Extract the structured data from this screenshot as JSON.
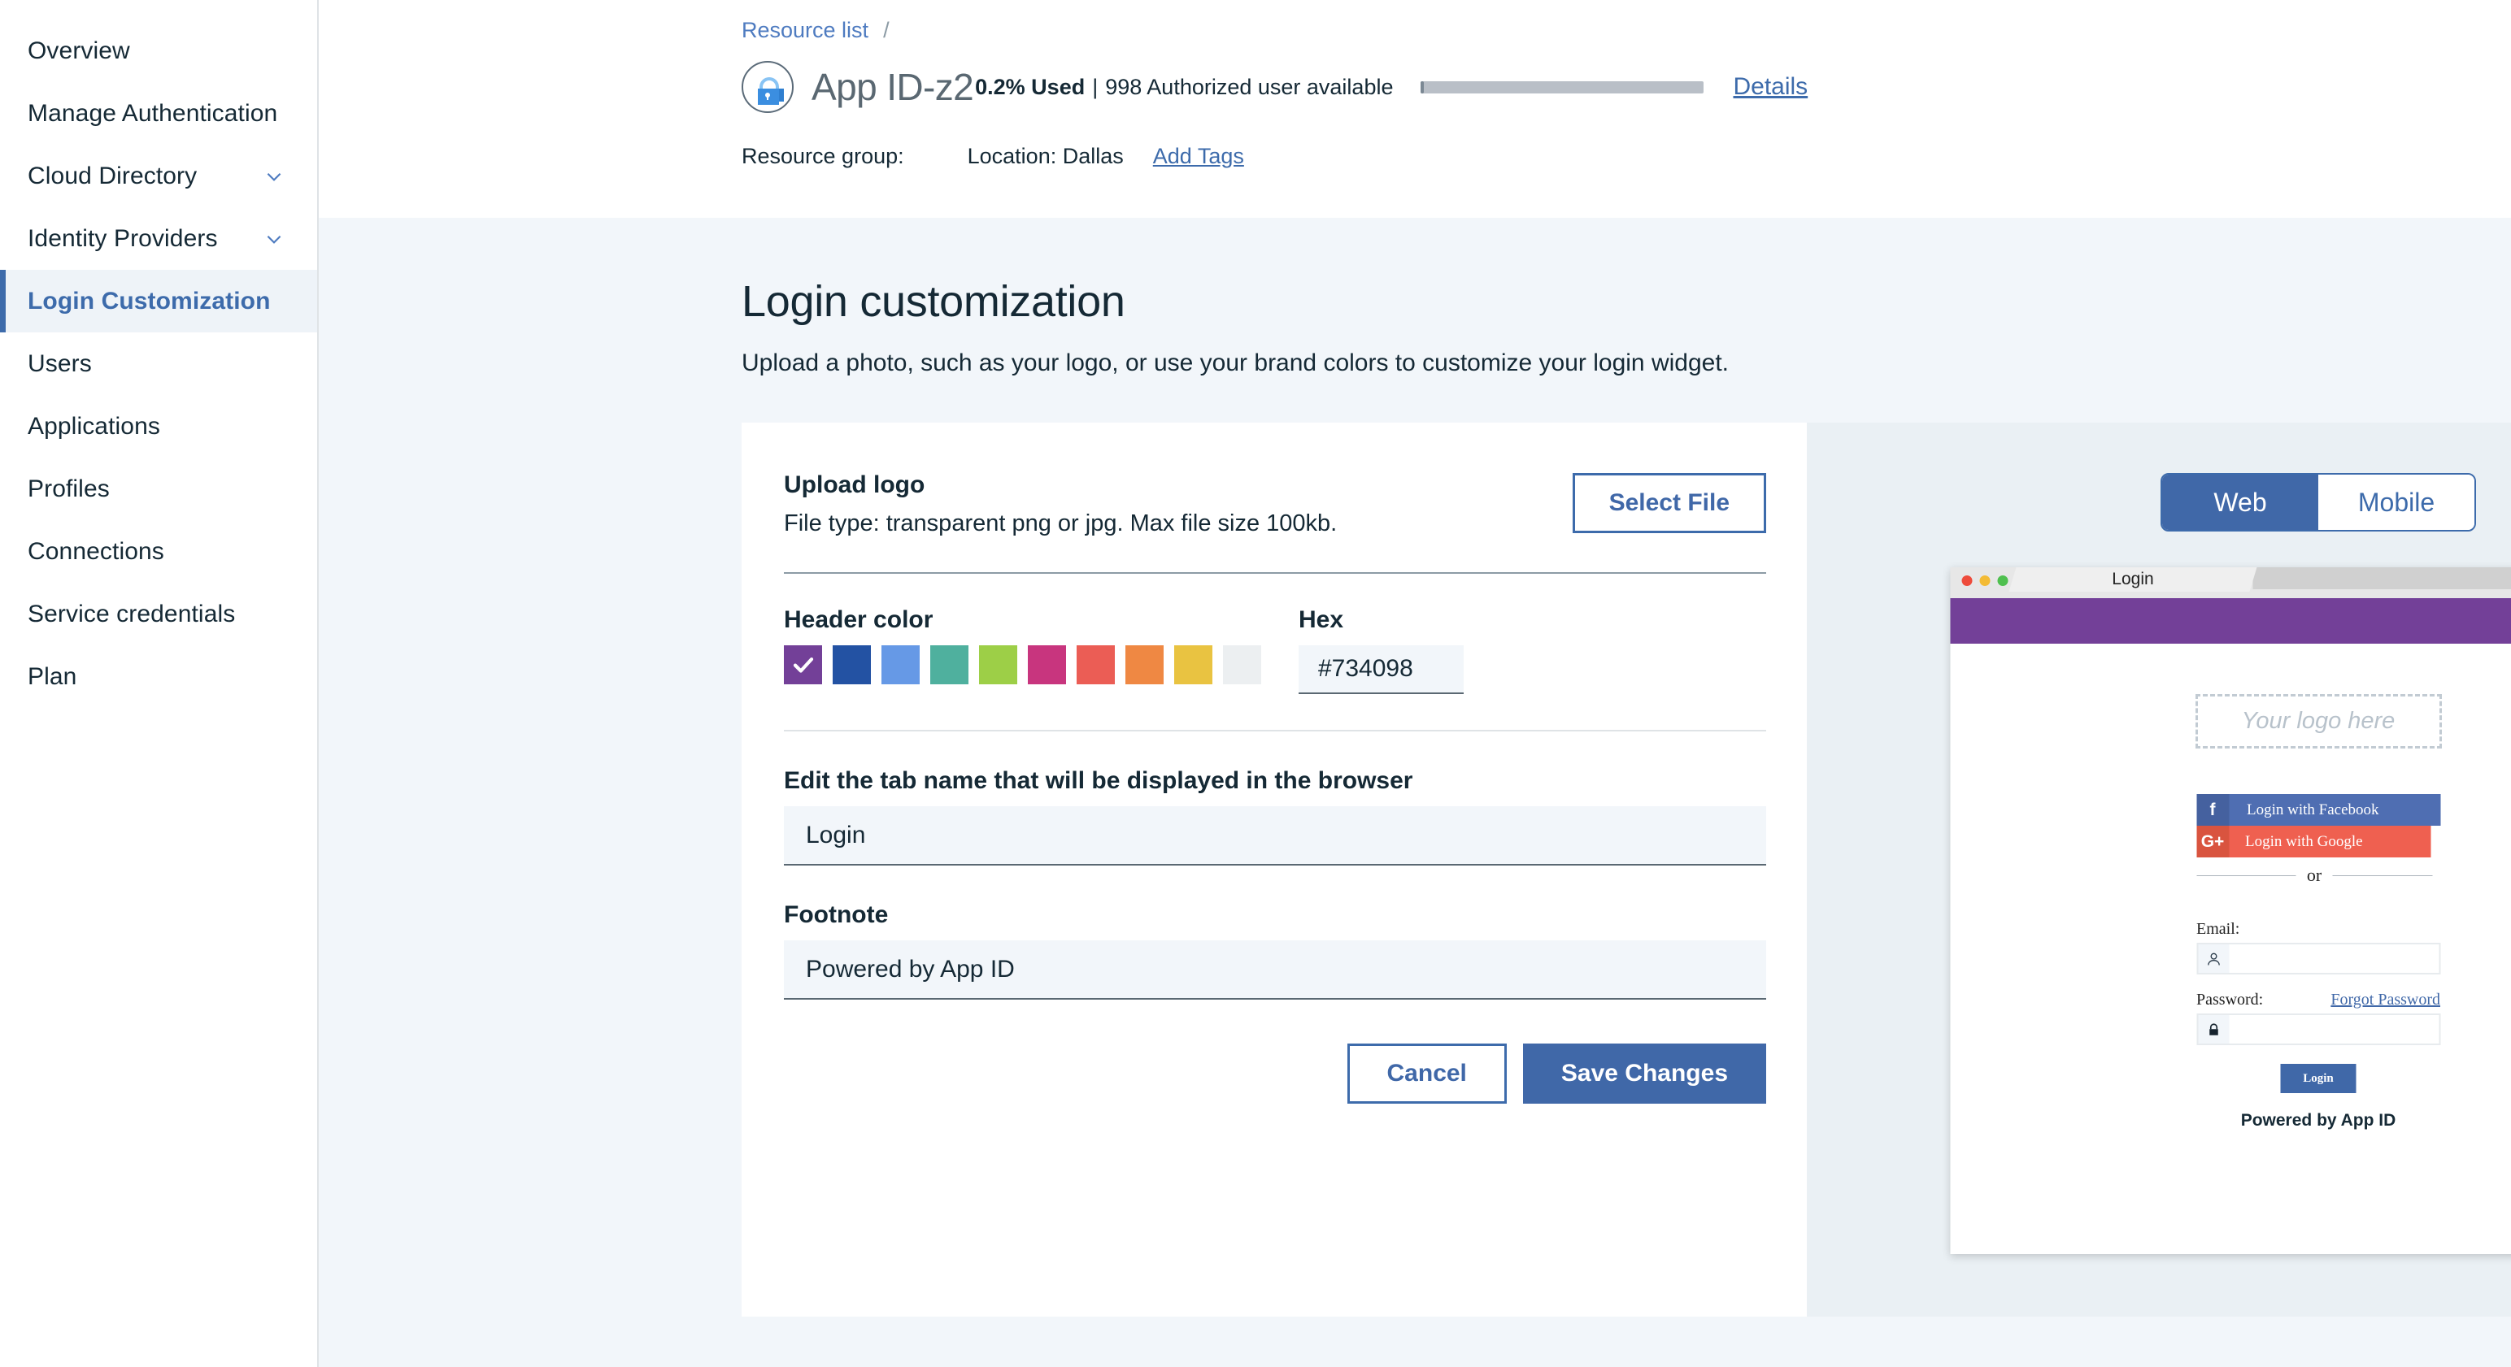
{
  "sidebar": {
    "items": [
      {
        "label": "Overview",
        "chevron": false,
        "active": false
      },
      {
        "label": "Manage Authentication",
        "chevron": false,
        "active": false
      },
      {
        "label": "Cloud Directory",
        "chevron": true,
        "active": false
      },
      {
        "label": "Identity Providers",
        "chevron": true,
        "active": false
      },
      {
        "label": "Login Customization",
        "chevron": false,
        "active": true
      },
      {
        "label": "Users",
        "chevron": false,
        "active": false
      },
      {
        "label": "Applications",
        "chevron": false,
        "active": false
      },
      {
        "label": "Profiles",
        "chevron": false,
        "active": false
      },
      {
        "label": "Connections",
        "chevron": false,
        "active": false
      },
      {
        "label": "Service credentials",
        "chevron": false,
        "active": false
      },
      {
        "label": "Plan",
        "chevron": false,
        "active": false
      }
    ]
  },
  "header": {
    "breadcrumb_link": "Resource list",
    "breadcrumb_sep": "/",
    "app_title": "App ID-z2",
    "usage_percent": "0.2% Used",
    "usage_separator": "|",
    "usage_available": "998 Authorized user available",
    "details_label": "Details",
    "resource_group_label": "Resource group:",
    "location_label": "Location:",
    "location_value": "Dallas",
    "add_tags_label": "Add Tags"
  },
  "page": {
    "title": "Login customization",
    "subtitle": "Upload a photo, such as your logo, or use your brand colors to customize your login widget."
  },
  "upload": {
    "title": "Upload logo",
    "description": "File type: transparent png or jpg. Max file size 100kb.",
    "select_file_label": "Select File"
  },
  "header_color": {
    "label": "Header color",
    "hex_label": "Hex",
    "hex_value": "#734098",
    "selected_index": 0,
    "swatches": [
      "#734098",
      "#2352a3",
      "#6699e6",
      "#4fb09e",
      "#9dcf47",
      "#c8357e",
      "#eb5d55",
      "#ef8843",
      "#e9c341",
      "#eceff1"
    ]
  },
  "tab_name_field": {
    "label": "Edit the tab name that will be displayed in the browser",
    "value": "Login"
  },
  "footnote_field": {
    "label": "Footnote",
    "value": "Powered by App ID"
  },
  "actions": {
    "cancel_label": "Cancel",
    "save_label": "Save Changes"
  },
  "preview": {
    "toggle": {
      "web_label": "Web",
      "mobile_label": "Mobile",
      "selected": "Web"
    },
    "browser_tab_title": "Login",
    "banner_color": "#734098",
    "logo_placeholder": "Your logo here",
    "facebook_label": "Login with Facebook",
    "facebook_icon": "f",
    "google_label": "Login with Google",
    "google_icon": "G+",
    "or_label": "or",
    "email_label": "Email:",
    "password_label": "Password:",
    "forgot_label": "Forgot Password",
    "login_button_label": "Login",
    "powered_label": "Powered by App ID"
  }
}
